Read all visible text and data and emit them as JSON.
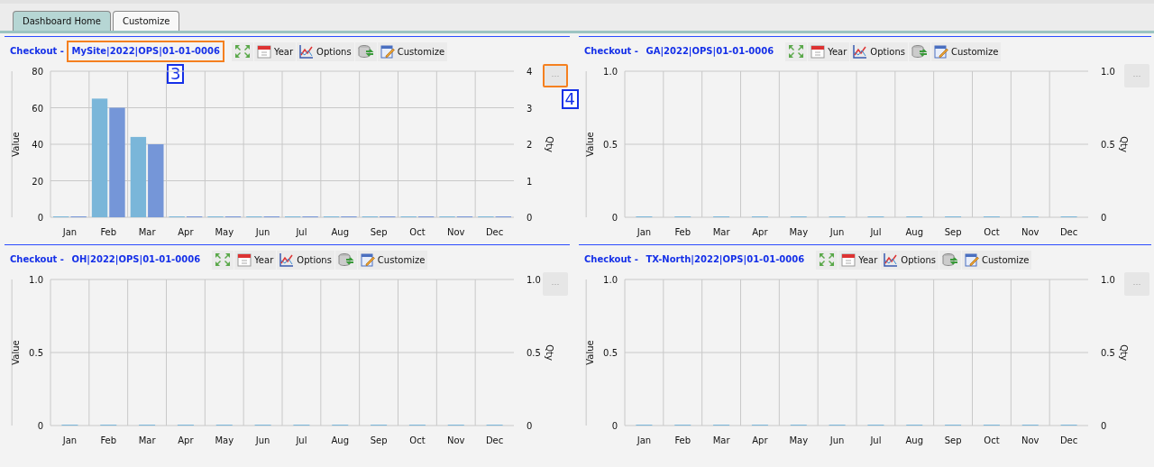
{
  "tabs": [
    {
      "label": "Dashboard Home",
      "selected": true
    },
    {
      "label": "Customize",
      "selected": false
    }
  ],
  "panels": [
    {
      "title": {
        "label": "Checkout -",
        "site": "MySite|2022|OPS|01-01-0006",
        "highlight": true,
        "callout": "3"
      },
      "toolbar": [
        {
          "kind": "expand"
        },
        {
          "kind": "calendar",
          "label": "Year"
        },
        {
          "kind": "chart",
          "label": "Options"
        },
        {
          "kind": "database"
        },
        {
          "kind": "notepad",
          "label": "Customize"
        }
      ],
      "menu": {
        "label": "···",
        "highlight": true,
        "callout": "4"
      },
      "chart_data": {
        "type": "bar",
        "ylabel": "Value",
        "y2label": "Qty",
        "categories": [
          "Jan",
          "Feb",
          "Mar",
          "Apr",
          "May",
          "Jun",
          "Jul",
          "Aug",
          "Sep",
          "Oct",
          "Nov",
          "Dec"
        ],
        "grid": true,
        "ylim": [
          0,
          80
        ],
        "yticks": [
          0,
          20,
          40,
          60,
          80
        ],
        "y2lim": [
          0,
          4
        ],
        "y2ticks": [
          0,
          1,
          2,
          3,
          4
        ],
        "series": [
          {
            "color": "#7ab6d9",
            "values": [
              0,
              65,
              44,
              0,
              0,
              0,
              0,
              0,
              0,
              0,
              0,
              0
            ]
          },
          {
            "color": "#7596d8",
            "values": [
              0,
              60,
              40,
              0,
              0,
              0,
              0,
              0,
              0,
              0,
              0,
              0
            ]
          }
        ]
      }
    },
    {
      "title": {
        "label": "Checkout -",
        "site": "GA|2022|OPS|01-01-0006"
      },
      "toolbar": [
        {
          "kind": "expand"
        },
        {
          "kind": "calendar",
          "label": "Year"
        },
        {
          "kind": "chart",
          "label": "Options"
        },
        {
          "kind": "database"
        },
        {
          "kind": "notepad",
          "label": "Customize"
        }
      ],
      "menu": {
        "label": "···",
        "highlight": false
      },
      "chart_data": {
        "type": "bar",
        "ylabel": "Value",
        "y2label": "Qty",
        "categories": [
          "Jan",
          "Feb",
          "Mar",
          "Apr",
          "May",
          "Jun",
          "Jul",
          "Aug",
          "Sep",
          "Oct",
          "Nov",
          "Dec"
        ],
        "grid": true,
        "ylim": [
          0,
          1
        ],
        "yticks": [
          {
            "value": 0,
            "label": "0"
          },
          {
            "value": 0.5,
            "label": "0.5"
          },
          {
            "value": 1,
            "label": "1.0"
          }
        ],
        "y2lim": [
          0,
          1
        ],
        "y2ticks": [
          {
            "value": 0,
            "label": "0"
          },
          {
            "value": 0.5,
            "label": "0.5"
          },
          {
            "value": 1,
            "label": "1.0"
          }
        ],
        "series": [
          {
            "color": "#7ab6d9",
            "values": [
              0,
              0,
              0,
              0,
              0,
              0,
              0,
              0,
              0,
              0,
              0,
              0
            ]
          }
        ]
      }
    },
    {
      "title": {
        "label": "Checkout -",
        "site": "OH|2022|OPS|01-01-0006"
      },
      "toolbar": [
        {
          "kind": "expand"
        },
        {
          "kind": "calendar",
          "label": "Year"
        },
        {
          "kind": "chart",
          "label": "Options"
        },
        {
          "kind": "database"
        },
        {
          "kind": "notepad",
          "label": "Customize"
        }
      ],
      "menu": {
        "label": "···",
        "highlight": false
      },
      "chart_data": {
        "type": "bar",
        "ylabel": "Value",
        "y2label": "Qty",
        "categories": [
          "Jan",
          "Feb",
          "Mar",
          "Apr",
          "May",
          "Jun",
          "Jul",
          "Aug",
          "Sep",
          "Oct",
          "Nov",
          "Dec"
        ],
        "grid": true,
        "ylim": [
          0,
          1
        ],
        "yticks": [
          {
            "value": 0,
            "label": "0"
          },
          {
            "value": 0.5,
            "label": "0.5"
          },
          {
            "value": 1,
            "label": "1.0"
          }
        ],
        "y2lim": [
          0,
          1
        ],
        "y2ticks": [
          {
            "value": 0,
            "label": "0"
          },
          {
            "value": 0.5,
            "label": "0.5"
          },
          {
            "value": 1,
            "label": "1.0"
          }
        ],
        "series": [
          {
            "color": "#7ab6d9",
            "values": [
              0,
              0,
              0,
              0,
              0,
              0,
              0,
              0,
              0,
              0,
              0,
              0
            ]
          }
        ]
      }
    },
    {
      "title": {
        "label": "Checkout -",
        "site": "TX-North|2022|OPS|01-01-0006"
      },
      "toolbar": [
        {
          "kind": "expand"
        },
        {
          "kind": "calendar",
          "label": "Year"
        },
        {
          "kind": "chart",
          "label": "Options"
        },
        {
          "kind": "database"
        },
        {
          "kind": "notepad",
          "label": "Customize"
        }
      ],
      "menu": {
        "label": "···",
        "highlight": false
      },
      "chart_data": {
        "type": "bar",
        "ylabel": "Value",
        "y2label": "Qty",
        "categories": [
          "Jan",
          "Feb",
          "Mar",
          "Apr",
          "May",
          "Jun",
          "Jul",
          "Aug",
          "Sep",
          "Oct",
          "Nov",
          "Dec"
        ],
        "grid": true,
        "ylim": [
          0,
          1
        ],
        "yticks": [
          {
            "value": 0,
            "label": "0"
          },
          {
            "value": 0.5,
            "label": "0.5"
          },
          {
            "value": 1,
            "label": "1.0"
          }
        ],
        "y2lim": [
          0,
          1
        ],
        "y2ticks": [
          {
            "value": 0,
            "label": "0"
          },
          {
            "value": 0.5,
            "label": "0.5"
          },
          {
            "value": 1,
            "label": "1.0"
          }
        ],
        "series": [
          {
            "color": "#7ab6d9",
            "values": [
              0,
              0,
              0,
              0,
              0,
              0,
              0,
              0,
              0,
              0,
              0,
              0
            ]
          }
        ]
      }
    }
  ]
}
